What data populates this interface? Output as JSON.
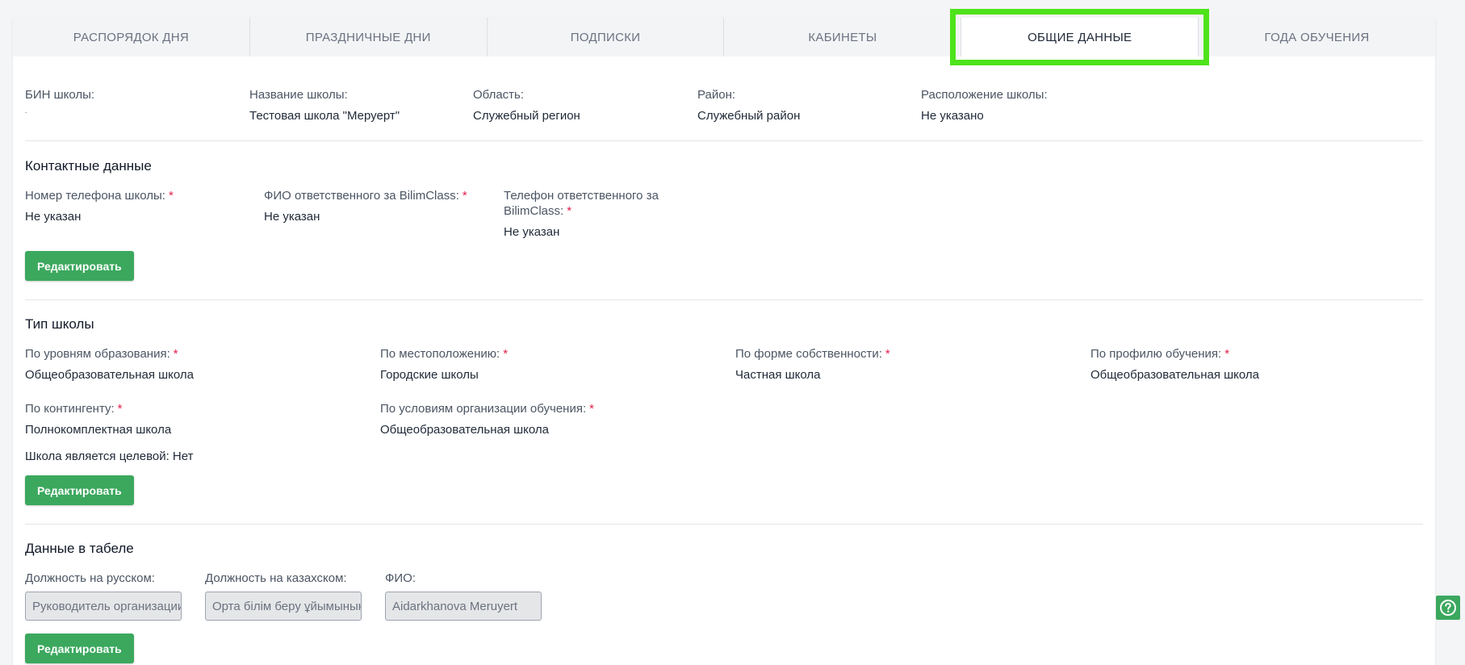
{
  "tabs": [
    {
      "label": "РАСПОРЯДОК ДНЯ",
      "active": false
    },
    {
      "label": "ПРАЗДНИЧНЫЕ ДНИ",
      "active": false
    },
    {
      "label": "ПОДПИСКИ",
      "active": false
    },
    {
      "label": "КАБИНЕТЫ",
      "active": false
    },
    {
      "label": "ОБЩИЕ ДАННЫЕ",
      "active": true
    },
    {
      "label": "ГОДА ОБУЧЕНИЯ",
      "active": false
    }
  ],
  "school_info": {
    "bin_label": "БИН школы:",
    "bin_value": ".",
    "name_label": "Название школы:",
    "name_value": "Тестовая школа \"Меруерт\"",
    "region_label": "Область:",
    "region_value": "Служебный регион",
    "district_label": "Район:",
    "district_value": "Служебный район",
    "location_label": "Расположение школы:",
    "location_value": "Не указано"
  },
  "contacts": {
    "title": "Контактные данные",
    "phone_label": "Номер телефона школы:",
    "phone_value": "Не указан",
    "responsible_label": "ФИО ответственного за BilimClass:",
    "responsible_value": "Не указан",
    "responsible_phone_label_1": "Телефон ответственного за",
    "responsible_phone_label_2": "BilimClass:",
    "responsible_phone_value": "Не указан",
    "required_mark": "*",
    "edit_label": "Редактировать"
  },
  "school_type": {
    "title": "Тип школы",
    "levels_label": "По уровням образования:",
    "levels_value": "Общеобразовательная школа",
    "location_label": "По местоположению:",
    "location_value": "Городские школы",
    "ownership_label": "По форме собственности:",
    "ownership_value": "Частная школа",
    "profile_label": "По профилю обучения:",
    "profile_value": "Общеобразовательная школа",
    "contingent_label": "По контингенту:",
    "contingent_value": "Полнокомплектная школа",
    "conditions_label": "По условиям организации обучения:",
    "conditions_value": "Общеобразовательная школа",
    "target_text": "Школа является целевой: Нет",
    "required_mark": "*",
    "edit_label": "Редактировать"
  },
  "timesheet": {
    "title": "Данные в табеле",
    "position_ru_label": "Должность на русском:",
    "position_ru_value": "Руководитель организации",
    "position_kz_label": "Должность на казахском:",
    "position_kz_value": "Орта білім беру ұйымының",
    "fio_label": "ФИО:",
    "fio_value": "Aidarkhanova Meruyert",
    "edit_label": "Редактировать"
  },
  "help": {
    "icon": "question-circle-icon"
  },
  "colors": {
    "accent": "#3ba85e",
    "highlight": "#4ee31b",
    "required": "#e11d48"
  }
}
